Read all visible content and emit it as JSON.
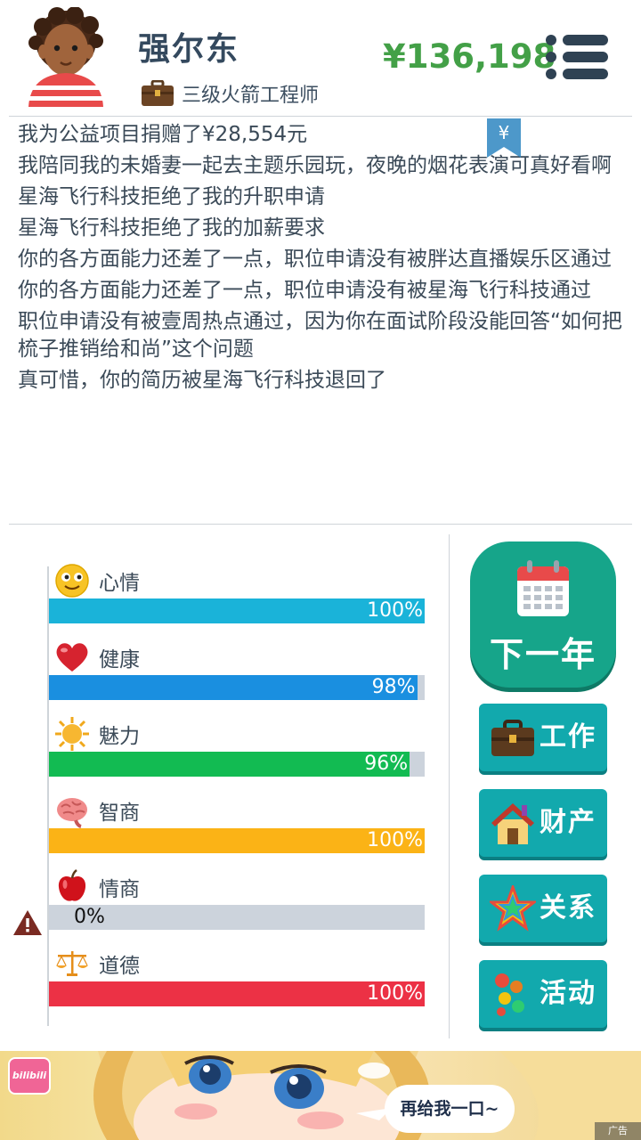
{
  "header": {
    "player_name": "强尔东",
    "job_title": "三级火箭工程师",
    "money": "¥136,198"
  },
  "log": {
    "bookmark_symbol": "¥",
    "entries": [
      "我为公益项目捐赠了¥28,554元",
      "我陪同我的未婚妻一起去主题乐园玩，夜晚的烟花表演可真好看啊",
      "星海飞行科技拒绝了我的升职申请",
      "星海飞行科技拒绝了我的加薪要求",
      "你的各方面能力还差了一点，职位申请没有被胖达直播娱乐区通过",
      "你的各方面能力还差了一点，职位申请没有被星海飞行科技通过",
      "职位申请没有被壹周热点通过，因为你在面试阶段没能回答“如何把梳子推销给和尚”这个问题",
      "真可惜，你的简历被星海飞行科技退回了"
    ]
  },
  "stats": [
    {
      "label": "心情",
      "value": 100,
      "text": "100%",
      "color": "#1ab3d9",
      "icon": "smiley-icon"
    },
    {
      "label": "健康",
      "value": 98,
      "text": "98%",
      "color": "#1a8fe0",
      "icon": "heart-icon"
    },
    {
      "label": "魅力",
      "value": 96,
      "text": "96%",
      "color": "#12bb52",
      "icon": "sun-icon"
    },
    {
      "label": "智商",
      "value": 100,
      "text": "100%",
      "color": "#fbb316",
      "icon": "brain-icon"
    },
    {
      "label": "情商",
      "value": 0,
      "text": "0%",
      "color": "#ccd3dc",
      "icon": "apple-icon",
      "warning": true
    },
    {
      "label": "道德",
      "value": 100,
      "text": "100%",
      "color": "#ec3145",
      "icon": "scales-icon"
    }
  ],
  "actions": {
    "next_year": "下一年",
    "work": "工作",
    "property": "财产",
    "relations": "关系",
    "activity": "活动"
  },
  "ad": {
    "logo_text": "bilibili",
    "bubble_text": "再给我一口~",
    "tag": "广告"
  }
}
